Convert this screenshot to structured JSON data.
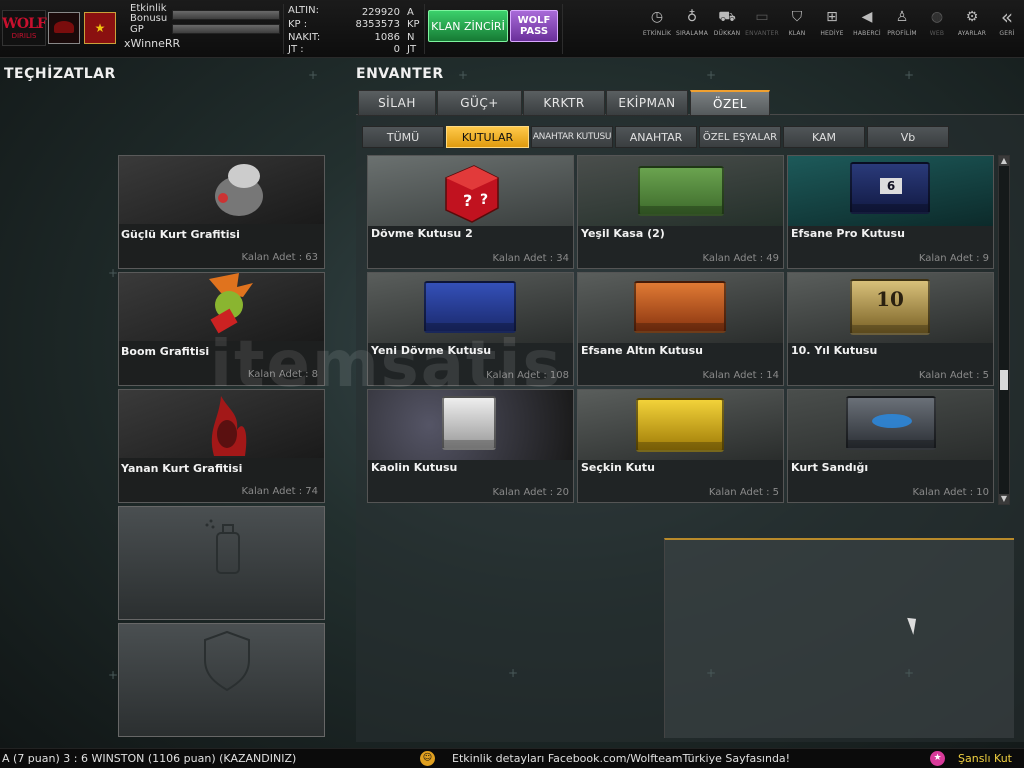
{
  "topbar": {
    "logo_text": "WOLF",
    "logo_sub": "DIRILIS",
    "bonus_label": "Etkinlik Bonusu",
    "gp_label": "GP",
    "username": "xWinneRR",
    "stats": [
      {
        "label": "ALTIN:",
        "value": "229920",
        "unit": "A"
      },
      {
        "label": "KP   :",
        "value": "8353573",
        "unit": "KP"
      },
      {
        "label": "NAKIT:",
        "value": "1086",
        "unit": "N"
      },
      {
        "label": "JT   :",
        "value": "0",
        "unit": "JT"
      }
    ],
    "klan_button": "KLAN ZİNCİRİ",
    "wolf_pass_button": "WOLF PASS",
    "nav": [
      {
        "label": "ETKİNLİK",
        "icon": "stopwatch-icon",
        "glyph": "◷"
      },
      {
        "label": "SIRALAMA",
        "icon": "medal-icon",
        "glyph": "♁"
      },
      {
        "label": "DÜKKAN",
        "icon": "cart-icon",
        "glyph": "⛟"
      },
      {
        "label": "ENVANTER",
        "icon": "inventory-icon",
        "glyph": "▭"
      },
      {
        "label": "KLAN",
        "icon": "shield-icon",
        "glyph": "⛉"
      },
      {
        "label": "HEDİYE",
        "icon": "gift-icon",
        "glyph": "⊞"
      },
      {
        "label": "HABERCİ",
        "icon": "megaphone-icon",
        "glyph": "◀"
      },
      {
        "label": "PROFİLİM",
        "icon": "profile-icon",
        "glyph": "♙"
      },
      {
        "label": "WEB",
        "icon": "globe-icon",
        "glyph": "◍"
      },
      {
        "label": "AYARLAR",
        "icon": "gear-icon",
        "glyph": "⚙"
      },
      {
        "label": "GERİ",
        "icon": "back-icon",
        "glyph": "«"
      }
    ]
  },
  "left": {
    "title": "TEÇHİZATLAR",
    "items": [
      {
        "name": "Güçlü Kurt Grafitisi",
        "count": "Kalan Adet : 63",
        "icon": "wolf-graffiti-icon"
      },
      {
        "name": "Boom Grafitisi",
        "count": "Kalan Adet : 8",
        "icon": "boom-graffiti-icon"
      },
      {
        "name": "Yanan Kurt Grafitisi",
        "count": "Kalan Adet : 74",
        "icon": "flame-wolf-graffiti-icon"
      }
    ],
    "empty_slots": [
      {
        "icon": "spray-can-icon"
      },
      {
        "icon": "shield-icon"
      }
    ]
  },
  "right": {
    "title": "ENVANTER",
    "tabs": [
      "SİLAH",
      "GÜÇ+",
      "KRKTR",
      "EKİPMAN",
      "ÖZEL"
    ],
    "active_tab": "ÖZEL",
    "subtabs": [
      "TÜMÜ",
      "KUTULAR",
      "ANAHTAR KUTUSU",
      "ANAHTAR",
      "ÖZEL EŞYALAR",
      "KAM",
      "Vb"
    ],
    "active_subtab": "KUTULAR",
    "items": [
      {
        "name": "Dövme Kutusu 2",
        "count": "Kalan Adet : 34",
        "color": "#c1121f"
      },
      {
        "name": "Yeşil Kasa (2)",
        "count": "Kalan Adet : 49",
        "color": "#4f8a3a"
      },
      {
        "name": "Efsane Pro Kutusu",
        "count": "Kalan Adet : 9",
        "color": "#1f2c66"
      },
      {
        "name": "Yeni Dövme Kutusu",
        "count": "Kalan Adet : 108",
        "color": "#22308a"
      },
      {
        "name": "Efsane Altın Kutusu",
        "count": "Kalan Adet : 14",
        "color": "#c0531c"
      },
      {
        "name": "10. Yıl Kutusu",
        "count": "Kalan Adet : 5",
        "color": "#b89a4a"
      },
      {
        "name": "Kaolin Kutusu",
        "count": "Kalan Adet : 20",
        "color": "#b5b5b5"
      },
      {
        "name": "Seçkin Kutu",
        "count": "Kalan Adet : 5",
        "color": "#d9b51a"
      },
      {
        "name": "Kurt Sandığı",
        "count": "Kalan Adet : 10",
        "color": "#4a4f55"
      }
    ]
  },
  "ticker": {
    "left_text": "A (7 puan) 3 : 6 WINSTON (1106 puan) (KAZANDINIZ)",
    "mid_text": "Etkinlik detayları Facebook.com/WolfteamTürkiye Sayfasında!",
    "right_text": "Şanslı Kut"
  },
  "watermark": "itemsatis",
  "colors": {
    "accent": "#f0a030",
    "active_subtab": "#ffc94a",
    "klan_green": "#2fb85a",
    "wolfpass_purple": "#8a4bbf"
  }
}
